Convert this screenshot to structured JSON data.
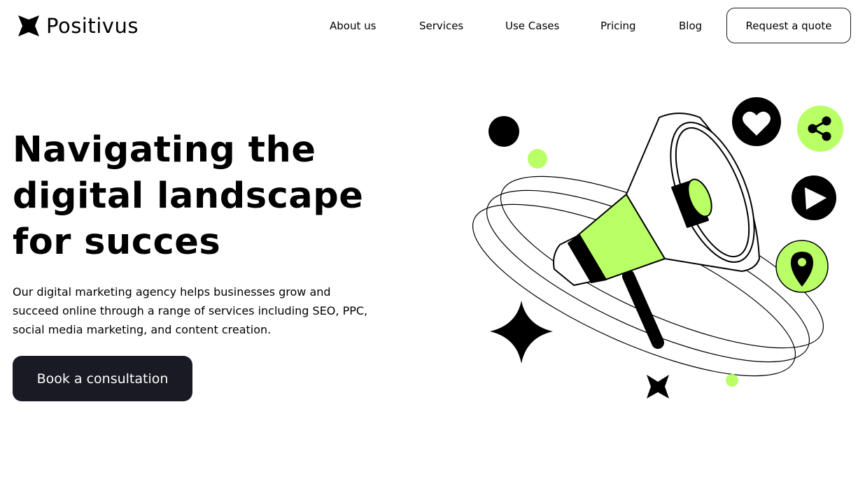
{
  "brand": {
    "name": "Positivus"
  },
  "nav": {
    "items": [
      {
        "label": "About us"
      },
      {
        "label": "Services"
      },
      {
        "label": "Use Cases"
      },
      {
        "label": "Pricing"
      },
      {
        "label": "Blog"
      }
    ],
    "cta_label": "Request a quote"
  },
  "hero": {
    "title_line1": "Navigating the",
    "title_line2": "digital landscape",
    "title_line3": "for succes",
    "description": "Our digital marketing agency helps businesses grow and succeed online through a range of services including SEO, PPC, social media marketing, and content creation.",
    "button_label": "Book a consultation"
  },
  "illustration": {
    "icons": [
      "megaphone-icon",
      "heart-icon",
      "share-icon",
      "play-icon",
      "location-pin-icon",
      "sparkle-star-icon"
    ]
  },
  "colors": {
    "accent": "#b9ff66",
    "dark": "#191a23",
    "background": "#ffffff"
  }
}
